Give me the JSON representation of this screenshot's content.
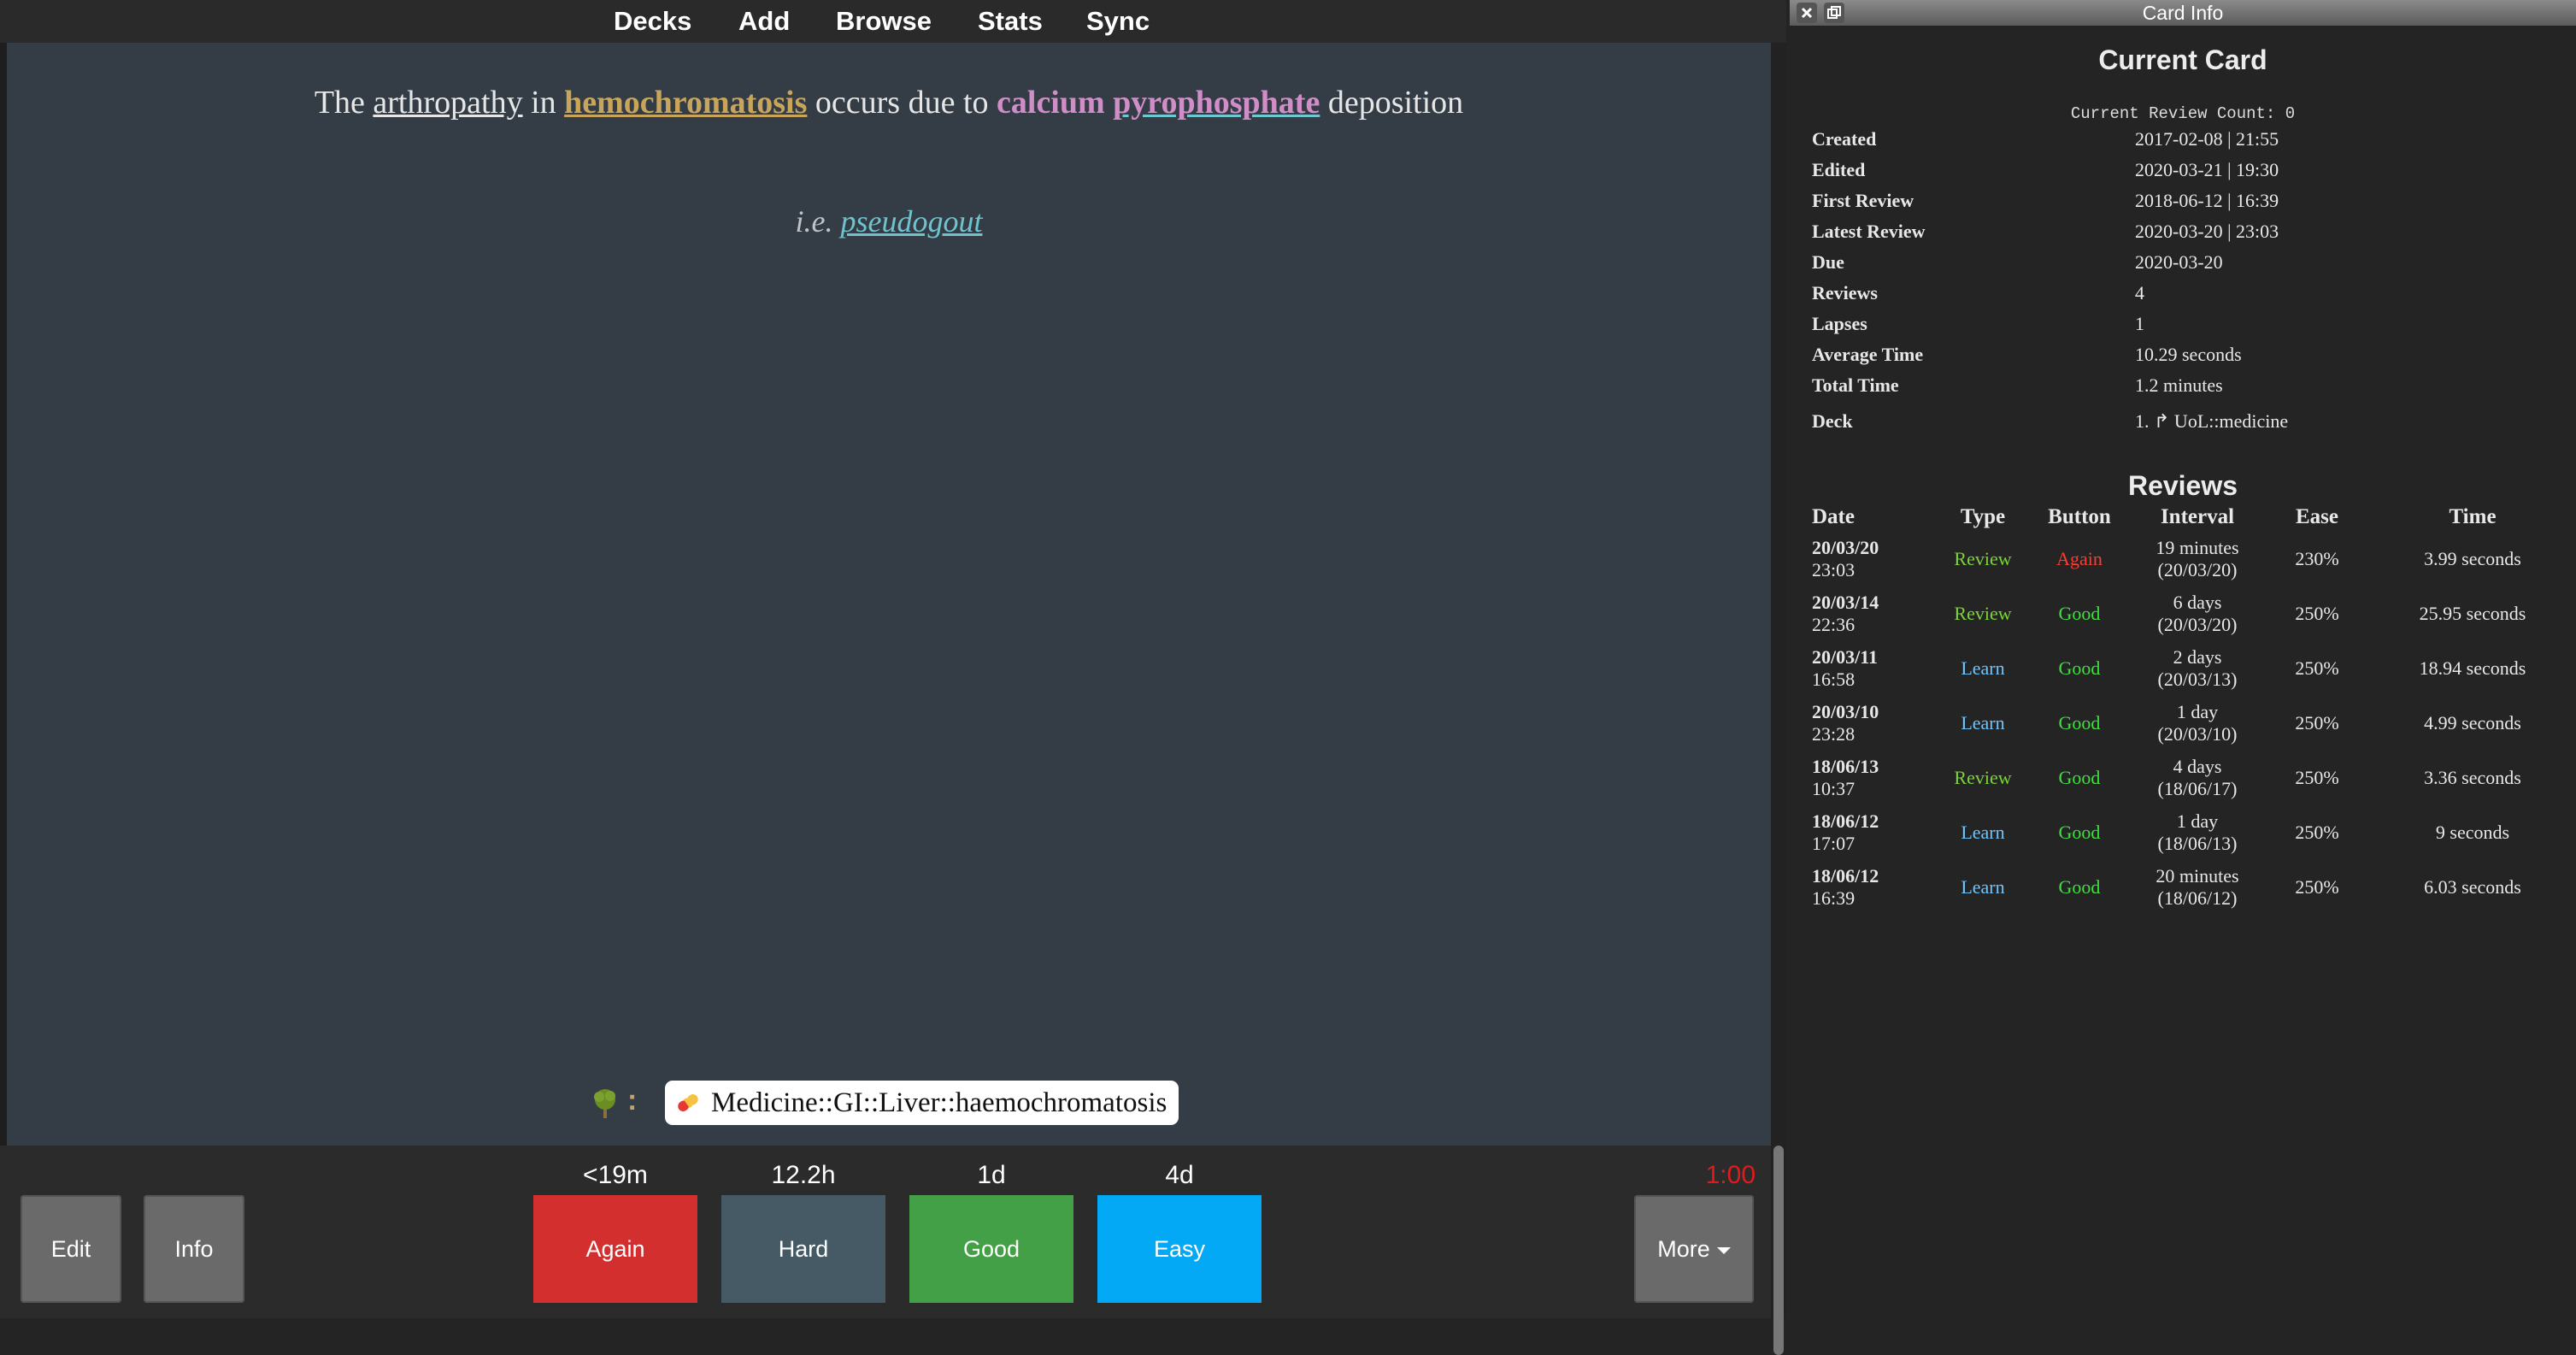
{
  "nav": [
    "Decks",
    "Add",
    "Browse",
    "Stats",
    "Sync"
  ],
  "card": {
    "q_the": "The",
    "q_arth": "arthropathy",
    "q_in": "in",
    "q_hemo": "hemochromatosis",
    "q_occurs": "occurs due to",
    "q_calc": "calcium",
    "q_pyro": "pyrophosphate",
    "q_dep": "deposition",
    "extra_prefix": "i.e.",
    "extra_link": "pseudogout",
    "tag_colon": ":",
    "tag": "Medicine::GI::Liver::haemochromatosis"
  },
  "bottom": {
    "edit": "Edit",
    "info": "Info",
    "timer": "1:00",
    "more": "More",
    "answers": [
      {
        "label": "Again",
        "interval": "<19m",
        "color": "#d32f2f"
      },
      {
        "label": "Hard",
        "interval": "12.2h",
        "color": "#455a64"
      },
      {
        "label": "Good",
        "interval": "1d",
        "color": "#43a047"
      },
      {
        "label": "Easy",
        "interval": "4d",
        "color": "#03a9f4"
      }
    ]
  },
  "panel": {
    "window_title": "Card Info",
    "heading": "Current Card",
    "review_count": "Current Review Count: 0",
    "info": [
      {
        "label": "Created",
        "value": "2017-02-08 | 21:55"
      },
      {
        "label": "Edited",
        "value": "2020-03-21 | 19:30"
      },
      {
        "label": "First Review",
        "value": "2018-06-12 | 16:39"
      },
      {
        "label": "Latest Review",
        "value": "2020-03-20 | 23:03"
      },
      {
        "label": "Due",
        "value": "2020-03-20"
      },
      {
        "label": "Reviews",
        "value": "4"
      },
      {
        "label": "Lapses",
        "value": "1"
      },
      {
        "label": "Average Time",
        "value": "10.29 seconds"
      },
      {
        "label": "Total Time",
        "value": "1.2 minutes"
      },
      {
        "label": "Deck",
        "value": "1. ↱ UoL::medicine"
      }
    ],
    "reviews_heading": "Reviews",
    "columns": [
      "Date",
      "Type",
      "Button",
      "Interval",
      "Ease",
      "Time"
    ],
    "rows": [
      {
        "date": "20/03/20",
        "clock": "23:03",
        "type": "Review",
        "button": "Again",
        "int1": "19 minutes",
        "int2": "(20/03/20)",
        "ease": "230%",
        "time": "3.99 seconds"
      },
      {
        "date": "20/03/14",
        "clock": "22:36",
        "type": "Review",
        "button": "Good",
        "int1": "6 days",
        "int2": "(20/03/20)",
        "ease": "250%",
        "time": "25.95 seconds"
      },
      {
        "date": "20/03/11",
        "clock": "16:58",
        "type": "Learn",
        "button": "Good",
        "int1": "2 days",
        "int2": "(20/03/13)",
        "ease": "250%",
        "time": "18.94 seconds"
      },
      {
        "date": "20/03/10",
        "clock": "23:28",
        "type": "Learn",
        "button": "Good",
        "int1": "1 day",
        "int2": "(20/03/10)",
        "ease": "250%",
        "time": "4.99 seconds"
      },
      {
        "date": "18/06/13",
        "clock": "10:37",
        "type": "Review",
        "button": "Good",
        "int1": "4 days",
        "int2": "(18/06/17)",
        "ease": "250%",
        "time": "3.36 seconds"
      },
      {
        "date": "18/06/12",
        "clock": "17:07",
        "type": "Learn",
        "button": "Good",
        "int1": "1 day",
        "int2": "(18/06/13)",
        "ease": "250%",
        "time": "9 seconds"
      },
      {
        "date": "18/06/12",
        "clock": "16:39",
        "type": "Learn",
        "button": "Good",
        "int1": "20 minutes",
        "int2": "(18/06/12)",
        "ease": "250%",
        "time": "6.03 seconds"
      }
    ]
  }
}
